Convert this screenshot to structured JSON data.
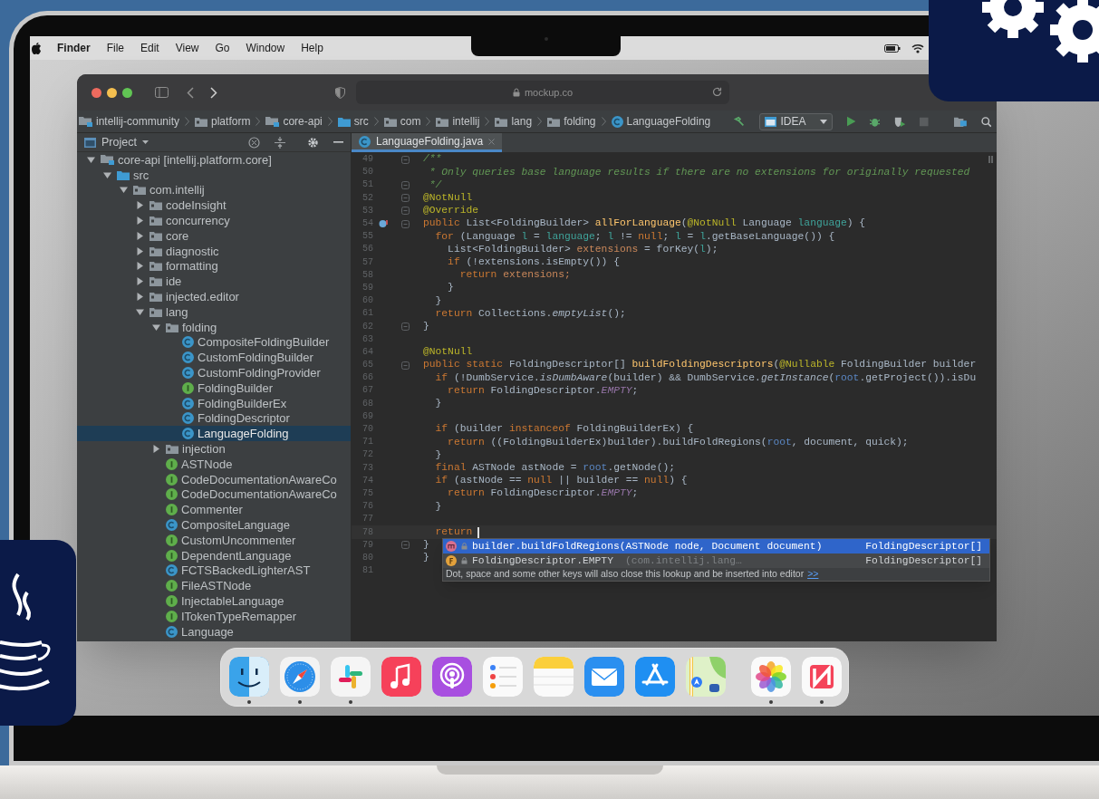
{
  "menu_bar": {
    "app_name": "Finder",
    "menus": [
      "File",
      "Edit",
      "View",
      "Go",
      "Window",
      "Help"
    ]
  },
  "browser": {
    "address": "mockup.co"
  },
  "breadcrumbs": [
    {
      "label": "intellij-community",
      "kind": "module"
    },
    {
      "label": "platform",
      "kind": "folder"
    },
    {
      "label": "core-api",
      "kind": "module"
    },
    {
      "label": "src",
      "kind": "source"
    },
    {
      "label": "com",
      "kind": "folder"
    },
    {
      "label": "intellij",
      "kind": "folder"
    },
    {
      "label": "lang",
      "kind": "folder"
    },
    {
      "label": "folding",
      "kind": "folder"
    },
    {
      "label": "LanguageFolding",
      "kind": "class"
    }
  ],
  "run_config": "IDEA",
  "project": {
    "title": "Project",
    "tree": [
      {
        "label": "core-api [intellij.platform.core]",
        "kind": "module",
        "expanded": true,
        "selected": false,
        "children": [
          {
            "label": "src",
            "kind": "source",
            "expanded": true,
            "selected": false,
            "children": [
              {
                "label": "com.intellij",
                "kind": "folder",
                "expanded": true,
                "selected": false,
                "children": [
                  {
                    "label": "codeInsight",
                    "kind": "folder",
                    "expanded": false,
                    "selected": false
                  },
                  {
                    "label": "concurrency",
                    "kind": "folder",
                    "expanded": false,
                    "selected": false
                  },
                  {
                    "label": "core",
                    "kind": "folder",
                    "expanded": false,
                    "selected": false
                  },
                  {
                    "label": "diagnostic",
                    "kind": "folder",
                    "expanded": false,
                    "selected": false
                  },
                  {
                    "label": "formatting",
                    "kind": "folder",
                    "expanded": false,
                    "selected": false
                  },
                  {
                    "label": "ide",
                    "kind": "folder",
                    "expanded": false,
                    "selected": false
                  },
                  {
                    "label": "injected.editor",
                    "kind": "folder",
                    "expanded": false,
                    "selected": false
                  },
                  {
                    "label": "lang",
                    "kind": "folder",
                    "expanded": true,
                    "selected": false,
                    "children": [
                      {
                        "label": "folding",
                        "kind": "folder",
                        "expanded": true,
                        "selected": false,
                        "children": [
                          {
                            "label": "CompositeFoldingBuilder",
                            "kind": "class",
                            "selected": false
                          },
                          {
                            "label": "CustomFoldingBuilder",
                            "kind": "class",
                            "selected": false
                          },
                          {
                            "label": "CustomFoldingProvider",
                            "kind": "class",
                            "selected": false
                          },
                          {
                            "label": "FoldingBuilder",
                            "kind": "interface",
                            "selected": false
                          },
                          {
                            "label": "FoldingBuilderEx",
                            "kind": "class",
                            "selected": false
                          },
                          {
                            "label": "FoldingDescriptor",
                            "kind": "class",
                            "selected": false
                          },
                          {
                            "label": "LanguageFolding",
                            "kind": "class",
                            "selected": true
                          }
                        ]
                      },
                      {
                        "label": "injection",
                        "kind": "folder",
                        "expanded": false,
                        "selected": false
                      },
                      {
                        "label": "ASTNode",
                        "kind": "interface",
                        "selected": false
                      },
                      {
                        "label": "CodeDocumentationAwareCo",
                        "kind": "interface",
                        "selected": false
                      },
                      {
                        "label": "CodeDocumentationAwareCo",
                        "kind": "interface",
                        "selected": false
                      },
                      {
                        "label": "Commenter",
                        "kind": "interface",
                        "selected": false
                      },
                      {
                        "label": "CompositeLanguage",
                        "kind": "class",
                        "selected": false
                      },
                      {
                        "label": "CustomUncommenter",
                        "kind": "interface",
                        "selected": false
                      },
                      {
                        "label": "DependentLanguage",
                        "kind": "interface",
                        "selected": false
                      },
                      {
                        "label": "FCTSBackedLighterAST",
                        "kind": "class",
                        "selected": false
                      },
                      {
                        "label": "FileASTNode",
                        "kind": "interface",
                        "selected": false
                      },
                      {
                        "label": "InjectableLanguage",
                        "kind": "interface",
                        "selected": false
                      },
                      {
                        "label": "ITokenTypeRemapper",
                        "kind": "interface",
                        "selected": false
                      },
                      {
                        "label": "Language",
                        "kind": "class",
                        "selected": false
                      }
                    ]
                  }
                ]
              }
            ]
          }
        ]
      }
    ]
  },
  "editor": {
    "tab": {
      "label": "LanguageFolding.java",
      "selected": true
    },
    "lines": [
      {
        "number": "49",
        "fold": true,
        "override": false,
        "tokens": [
          {
            "kind": "comment",
            "text": "/**"
          }
        ]
      },
      {
        "number": "50",
        "fold": false,
        "override": false,
        "tokens": [
          {
            "kind": "comment",
            "text": " * Only queries base language results if there are no extensions for originally requested"
          }
        ]
      },
      {
        "number": "51",
        "fold": true,
        "override": false,
        "tokens": [
          {
            "kind": "comment",
            "text": " */"
          }
        ]
      },
      {
        "number": "52",
        "fold": true,
        "override": false,
        "tokens": [
          {
            "kind": "annotation",
            "text": "@NotNull"
          }
        ]
      },
      {
        "number": "53",
        "fold": true,
        "override": false,
        "tokens": [
          {
            "kind": "annotation",
            "text": "@Override"
          }
        ]
      },
      {
        "number": "54",
        "fold": true,
        "override": true,
        "tokens": [
          {
            "kind": "keyword",
            "text": "public"
          },
          {
            "kind": "plain",
            "text": " List<FoldingBuilder> "
          },
          {
            "kind": "method",
            "text": "allForLanguage"
          },
          {
            "kind": "plain",
            "text": "("
          },
          {
            "kind": "annotation",
            "text": "@NotNull"
          },
          {
            "kind": "plain",
            "text": " Language "
          },
          {
            "kind": "param",
            "text": "language"
          },
          {
            "kind": "plain",
            "text": ") {"
          }
        ]
      },
      {
        "number": "55",
        "fold": false,
        "override": false,
        "tokens": [
          {
            "kind": "keyword",
            "text": "  for"
          },
          {
            "kind": "plain",
            "text": " (Language "
          },
          {
            "kind": "param",
            "text": "l"
          },
          {
            "kind": "plain",
            "text": " = "
          },
          {
            "kind": "param",
            "text": "language"
          },
          {
            "kind": "plain",
            "text": "; "
          },
          {
            "kind": "param",
            "text": "l"
          },
          {
            "kind": "plain",
            "text": " != "
          },
          {
            "kind": "keyword",
            "text": "null"
          },
          {
            "kind": "plain",
            "text": "; "
          },
          {
            "kind": "param",
            "text": "l"
          },
          {
            "kind": "plain",
            "text": " = "
          },
          {
            "kind": "param",
            "text": "l"
          },
          {
            "kind": "plain",
            "text": ".getBaseLanguage()) {"
          }
        ]
      },
      {
        "number": "56",
        "fold": false,
        "override": false,
        "tokens": [
          {
            "kind": "plain",
            "text": "    List<FoldingBuilder> "
          },
          {
            "kind": "variable",
            "text": "extensions"
          },
          {
            "kind": "plain",
            "text": " = forKey("
          },
          {
            "kind": "param",
            "text": "l"
          },
          {
            "kind": "plain",
            "text": ");"
          }
        ]
      },
      {
        "number": "57",
        "fold": false,
        "override": false,
        "tokens": [
          {
            "kind": "keyword",
            "text": "    if"
          },
          {
            "kind": "plain",
            "text": " (!extensions.isEmpty()) {"
          }
        ]
      },
      {
        "number": "58",
        "fold": false,
        "override": false,
        "tokens": [
          {
            "kind": "keyword",
            "text": "      return"
          },
          {
            "kind": "variable",
            "text": " extensions;"
          }
        ]
      },
      {
        "number": "59",
        "fold": false,
        "override": false,
        "tokens": [
          {
            "kind": "plain",
            "text": "    }"
          }
        ]
      },
      {
        "number": "60",
        "fold": false,
        "override": false,
        "tokens": [
          {
            "kind": "plain",
            "text": "  }"
          }
        ]
      },
      {
        "number": "61",
        "fold": false,
        "override": false,
        "tokens": [
          {
            "kind": "keyword",
            "text": "  return"
          },
          {
            "kind": "plain",
            "text": " Collections."
          },
          {
            "kind": "static_method",
            "text": "emptyList"
          },
          {
            "kind": "plain",
            "text": "();"
          }
        ]
      },
      {
        "number": "62",
        "fold": true,
        "override": false,
        "tokens": [
          {
            "kind": "plain",
            "text": "}"
          }
        ]
      },
      {
        "number": "63",
        "fold": false,
        "override": false
      },
      {
        "number": "64",
        "fold": false,
        "override": false,
        "tokens": [
          {
            "kind": "annotation",
            "text": "@NotNull"
          }
        ]
      },
      {
        "number": "65",
        "fold": true,
        "override": false,
        "tokens": [
          {
            "kind": "keyword",
            "text": "public static"
          },
          {
            "kind": "plain",
            "text": " FoldingDescriptor[] "
          },
          {
            "kind": "method",
            "text": "buildFoldingDescriptors"
          },
          {
            "kind": "plain",
            "text": "("
          },
          {
            "kind": "annotation",
            "text": "@Nullable"
          },
          {
            "kind": "plain",
            "text": " FoldingBuilder builder"
          }
        ]
      },
      {
        "number": "66",
        "fold": false,
        "override": false,
        "tokens": [
          {
            "kind": "keyword",
            "text": "  if"
          },
          {
            "kind": "plain",
            "text": " (!DumbService."
          },
          {
            "kind": "static_method",
            "text": "isDumbAware"
          },
          {
            "kind": "plain",
            "text": "(builder) && DumbService."
          },
          {
            "kind": "static_method",
            "text": "getInstance"
          },
          {
            "kind": "plain",
            "text": "("
          },
          {
            "kind": "global",
            "text": "root"
          },
          {
            "kind": "plain",
            "text": ".getProject()).isDu"
          }
        ]
      },
      {
        "number": "67",
        "fold": false,
        "override": false,
        "tokens": [
          {
            "kind": "keyword",
            "text": "    return"
          },
          {
            "kind": "plain",
            "text": " FoldingDescriptor."
          },
          {
            "kind": "constant",
            "text": "EMPTY"
          },
          {
            "kind": "plain",
            "text": ";"
          }
        ]
      },
      {
        "number": "68",
        "fold": false,
        "override": false,
        "tokens": [
          {
            "kind": "plain",
            "text": "  }"
          }
        ]
      },
      {
        "number": "69",
        "fold": false,
        "override": false
      },
      {
        "number": "70",
        "fold": false,
        "override": false,
        "tokens": [
          {
            "kind": "keyword",
            "text": "  if"
          },
          {
            "kind": "plain",
            "text": " (builder "
          },
          {
            "kind": "keyword",
            "text": "instanceof"
          },
          {
            "kind": "plain",
            "text": " FoldingBuilderEx) {"
          }
        ]
      },
      {
        "number": "71",
        "fold": false,
        "override": false,
        "tokens": [
          {
            "kind": "keyword",
            "text": "    return"
          },
          {
            "kind": "plain",
            "text": " ((FoldingBuilderEx)builder).buildFoldRegions("
          },
          {
            "kind": "global",
            "text": "root"
          },
          {
            "kind": "plain",
            "text": ", document, quick);"
          }
        ]
      },
      {
        "number": "72",
        "fold": false,
        "override": false,
        "tokens": [
          {
            "kind": "plain",
            "text": "  }"
          }
        ]
      },
      {
        "number": "73",
        "fold": false,
        "override": false,
        "tokens": [
          {
            "kind": "keyword",
            "text": "  final"
          },
          {
            "kind": "plain",
            "text": " ASTNode astNode = "
          },
          {
            "kind": "global",
            "text": "root"
          },
          {
            "kind": "plain",
            "text": ".getNode();"
          }
        ]
      },
      {
        "number": "74",
        "fold": false,
        "override": false,
        "tokens": [
          {
            "kind": "keyword",
            "text": "  if"
          },
          {
            "kind": "plain",
            "text": " (astNode == "
          },
          {
            "kind": "keyword",
            "text": "null"
          },
          {
            "kind": "plain",
            "text": " || builder == "
          },
          {
            "kind": "keyword",
            "text": "null"
          },
          {
            "kind": "plain",
            "text": ") {"
          }
        ]
      },
      {
        "number": "75",
        "fold": false,
        "override": false,
        "tokens": [
          {
            "kind": "keyword",
            "text": "    return"
          },
          {
            "kind": "plain",
            "text": " FoldingDescriptor."
          },
          {
            "kind": "constant",
            "text": "EMPTY"
          },
          {
            "kind": "plain",
            "text": ";"
          }
        ]
      },
      {
        "number": "76",
        "fold": false,
        "override": false,
        "tokens": [
          {
            "kind": "plain",
            "text": "  }"
          }
        ]
      },
      {
        "number": "77",
        "fold": false,
        "override": false
      },
      {
        "number": "78",
        "fold": false,
        "override": false,
        "tokens": [
          {
            "kind": "keyword",
            "text": "  return"
          },
          {
            "kind": "caret"
          }
        ]
      },
      {
        "number": "79",
        "fold": true,
        "override": false,
        "tokens": [
          {
            "kind": "plain",
            "text": "}"
          }
        ]
      },
      {
        "number": "80",
        "fold": false,
        "override": false,
        "tokens": [
          {
            "kind": "plain",
            "text": "}"
          }
        ]
      },
      {
        "number": "81",
        "fold": false,
        "override": false
      }
    ],
    "completion": {
      "items": [
        {
          "kind": "method",
          "text": "builder.buildFoldRegions(ASTNode node, Document document)",
          "type": "FoldingDescriptor[]",
          "selected": true
        },
        {
          "kind": "field",
          "text": "FoldingDescriptor.EMPTY",
          "hint": "(com.intellij.lang…",
          "type": "FoldingDescriptor[]",
          "selected": false
        }
      ],
      "footer": "Dot, space and some other keys will also close this lookup and be inserted into editor",
      "footer_link": ">>"
    }
  },
  "dock": {
    "apps": [
      {
        "kind": "finder",
        "running": true
      },
      {
        "kind": "safari",
        "running": true
      },
      {
        "kind": "slack",
        "running": true
      },
      {
        "kind": "music",
        "running": false
      },
      {
        "kind": "podcasts",
        "running": false
      },
      {
        "kind": "reminders",
        "running": false
      },
      {
        "kind": "notes",
        "running": false
      },
      {
        "kind": "mail",
        "running": false
      },
      {
        "kind": "appstore",
        "running": false
      },
      {
        "kind": "maps",
        "running": false
      }
    ],
    "recent": [
      {
        "kind": "photos",
        "running": true
      },
      {
        "kind": "news",
        "running": true
      }
    ]
  }
}
